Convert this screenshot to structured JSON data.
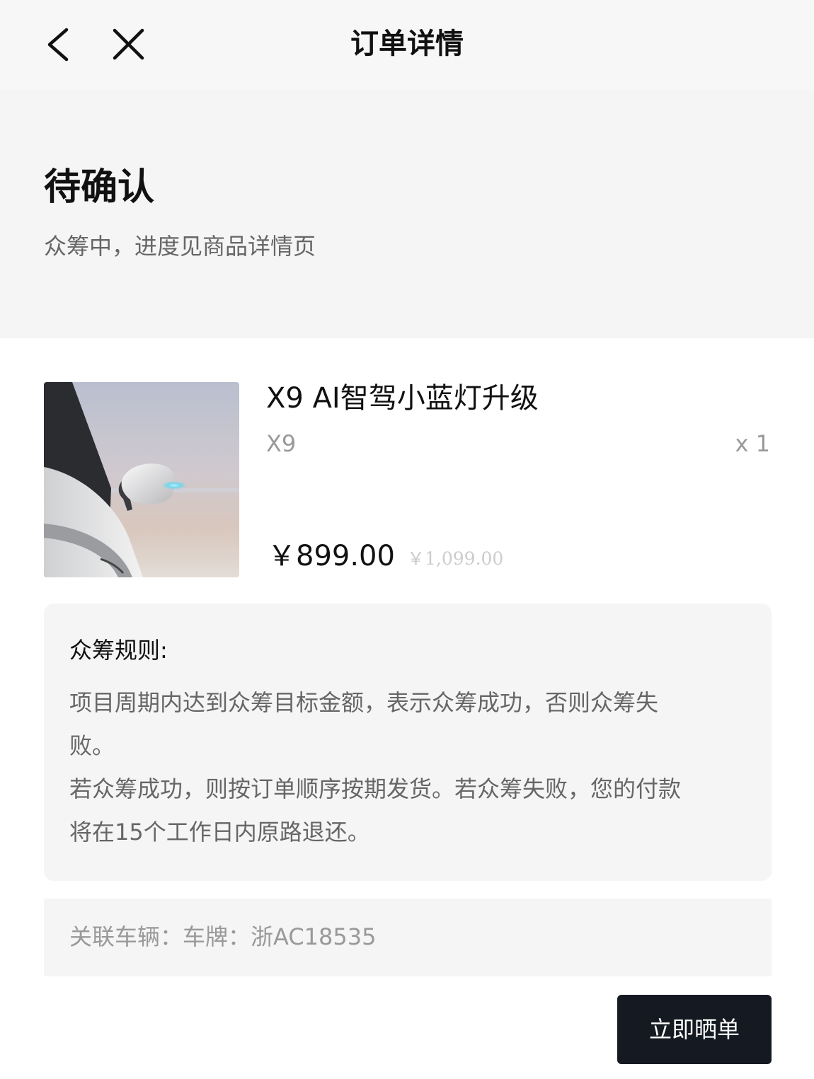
{
  "nav": {
    "back_icon": "chevron-left-icon",
    "close_icon": "close-icon",
    "title": "订单详情"
  },
  "status": {
    "title": "待确认",
    "subtitle": "众筹中，进度见商品详情页"
  },
  "product": {
    "name": "X9 AI智驾小蓝灯升级",
    "model": "X9",
    "quantity": "x 1",
    "price": "￥899.00",
    "original_price": "￥1,099.00"
  },
  "rules": {
    "title": "众筹规则:",
    "lines": [
      "项目周期内达到众筹目标金额，表示众筹成功，否则众筹失",
      "败。",
      "若众筹成功，则按订单顺序按期发货。若众筹失败，您的付款",
      "将在15个工作日内原路退还。"
    ]
  },
  "vehicle": {
    "text": "关联车辆：车牌：浙AC18535"
  },
  "action": {
    "label": "立即晒单"
  },
  "colors": {
    "button_bg": "#151a22",
    "page_bg": "#f5f5f5",
    "secondary_text": "#999999"
  }
}
